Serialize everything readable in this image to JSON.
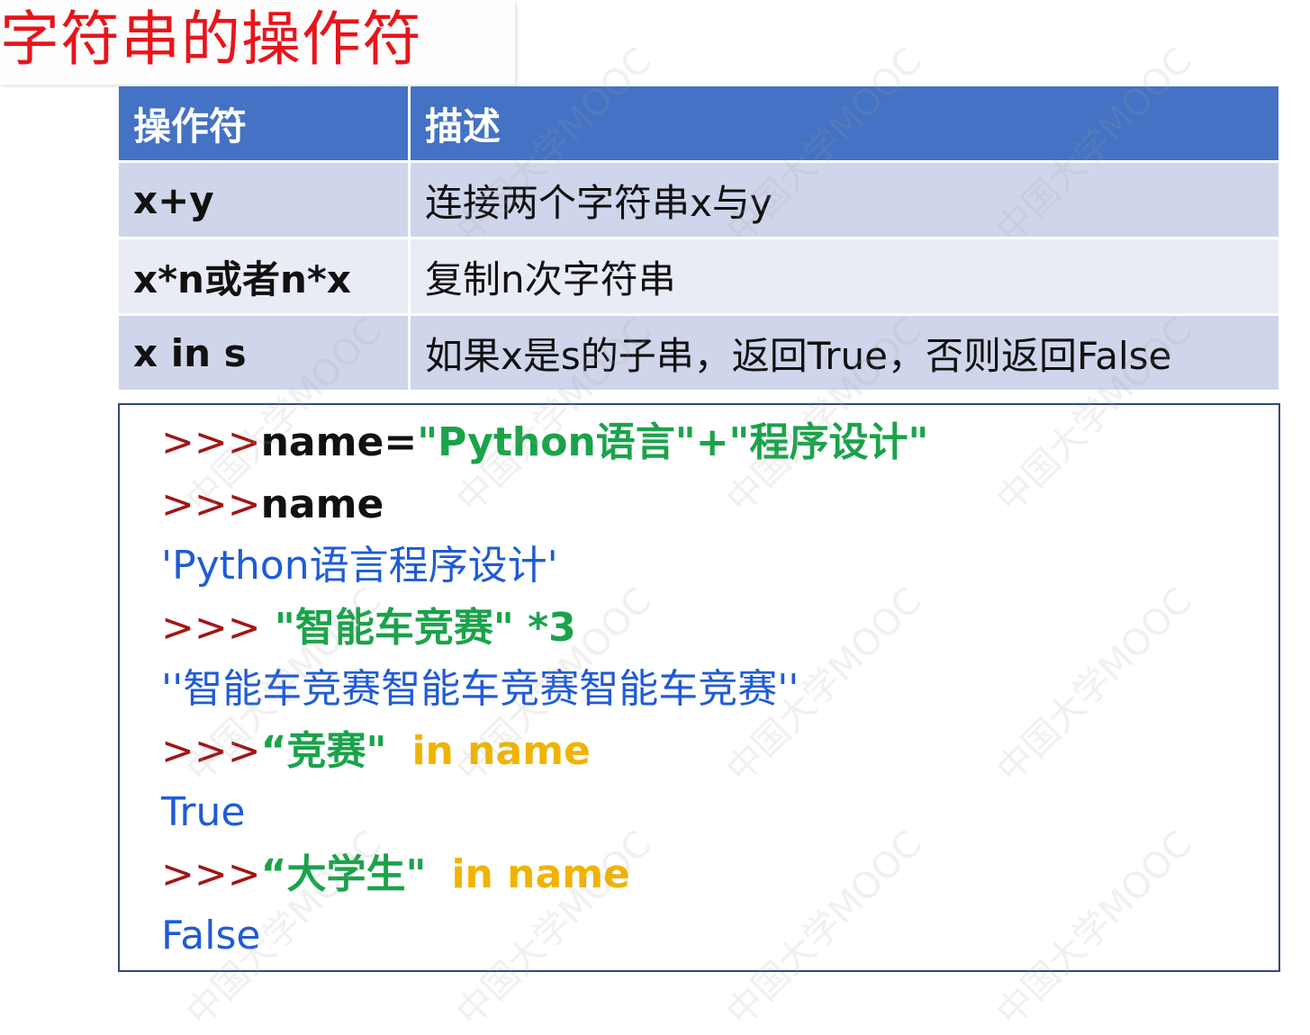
{
  "title": "字符串的操作符",
  "table": {
    "headers": [
      "操作符",
      "描述"
    ],
    "rows": [
      {
        "op": "x+y",
        "desc": "连接两个字符串x与y"
      },
      {
        "op": "x*n或者n*x",
        "desc": "复制n次字符串"
      },
      {
        "op": "x in s",
        "desc": "如果x是s的子串，返回True，否则返回False"
      }
    ]
  },
  "code": {
    "prompt": ">>>",
    "l1": {
      "var": "name=",
      "str": "\"Python语言\"+\"程序设计\""
    },
    "l2": {
      "var": "name"
    },
    "l3": "'Python语言程序设计'",
    "l4": {
      "str": " \"智能车竞赛\" *3"
    },
    "l5": "''智能车竞赛智能车竞赛智能车竞赛''",
    "l6": {
      "str": "“竞赛\"",
      "in": "in",
      "var": " name"
    },
    "l7": "True",
    "l8": {
      "str": "“大学生\"",
      "in": "in",
      "var": " name"
    },
    "l9": "False"
  },
  "watermark": "中国大学MOOC",
  "colors": {
    "title": "#e8141b",
    "header_bg": "#4472c4",
    "row_odd": "#cfd5ea",
    "row_even": "#e9ebf5",
    "prompt": "#a31515",
    "string": "#1aa34a",
    "in_keyword": "#f0b400",
    "output": "#1f5bd8"
  }
}
